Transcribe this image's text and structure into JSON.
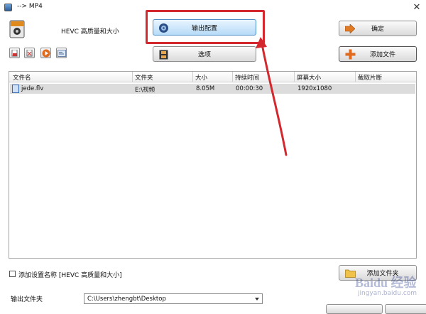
{
  "window": {
    "title": "--> MP4"
  },
  "profile": {
    "label": "HEVC 高质量和大小"
  },
  "buttons": {
    "output_config": "输出配置",
    "confirm": "确定",
    "options": "选项",
    "add_file": "添加文件",
    "add_folder": "添加文件夹"
  },
  "table": {
    "headers": [
      "文件名",
      "文件夹",
      "大小",
      "持续时间",
      "屏幕大小",
      "截取片断"
    ],
    "rows": [
      {
        "name": "jede.flv",
        "folder": "E:\\视频",
        "size": "8.05M",
        "duration": "00:00:30",
        "screen": "1920x1080",
        "clip": ""
      }
    ]
  },
  "checkbox": {
    "label": "添加设置名称 [HEVC 高质量和大小]",
    "checked": false
  },
  "output": {
    "label": "输出文件夹",
    "path": "C:\\Users\\zhengbt\\Desktop"
  },
  "watermark": {
    "text": "Baidu 经验",
    "sub": "jingyan.baidu.com"
  },
  "colors": {
    "highlight": "#d3282e",
    "primary_button": "#b7dbf7",
    "selected_row": "#dcdcdc"
  },
  "icons": [
    "app-icon",
    "close-icon",
    "mp4-profile-icon",
    "gear-disc-icon",
    "film-icon",
    "arrow-right-icon",
    "plus-icon",
    "folder-icon",
    "chevron-down-icon"
  ]
}
